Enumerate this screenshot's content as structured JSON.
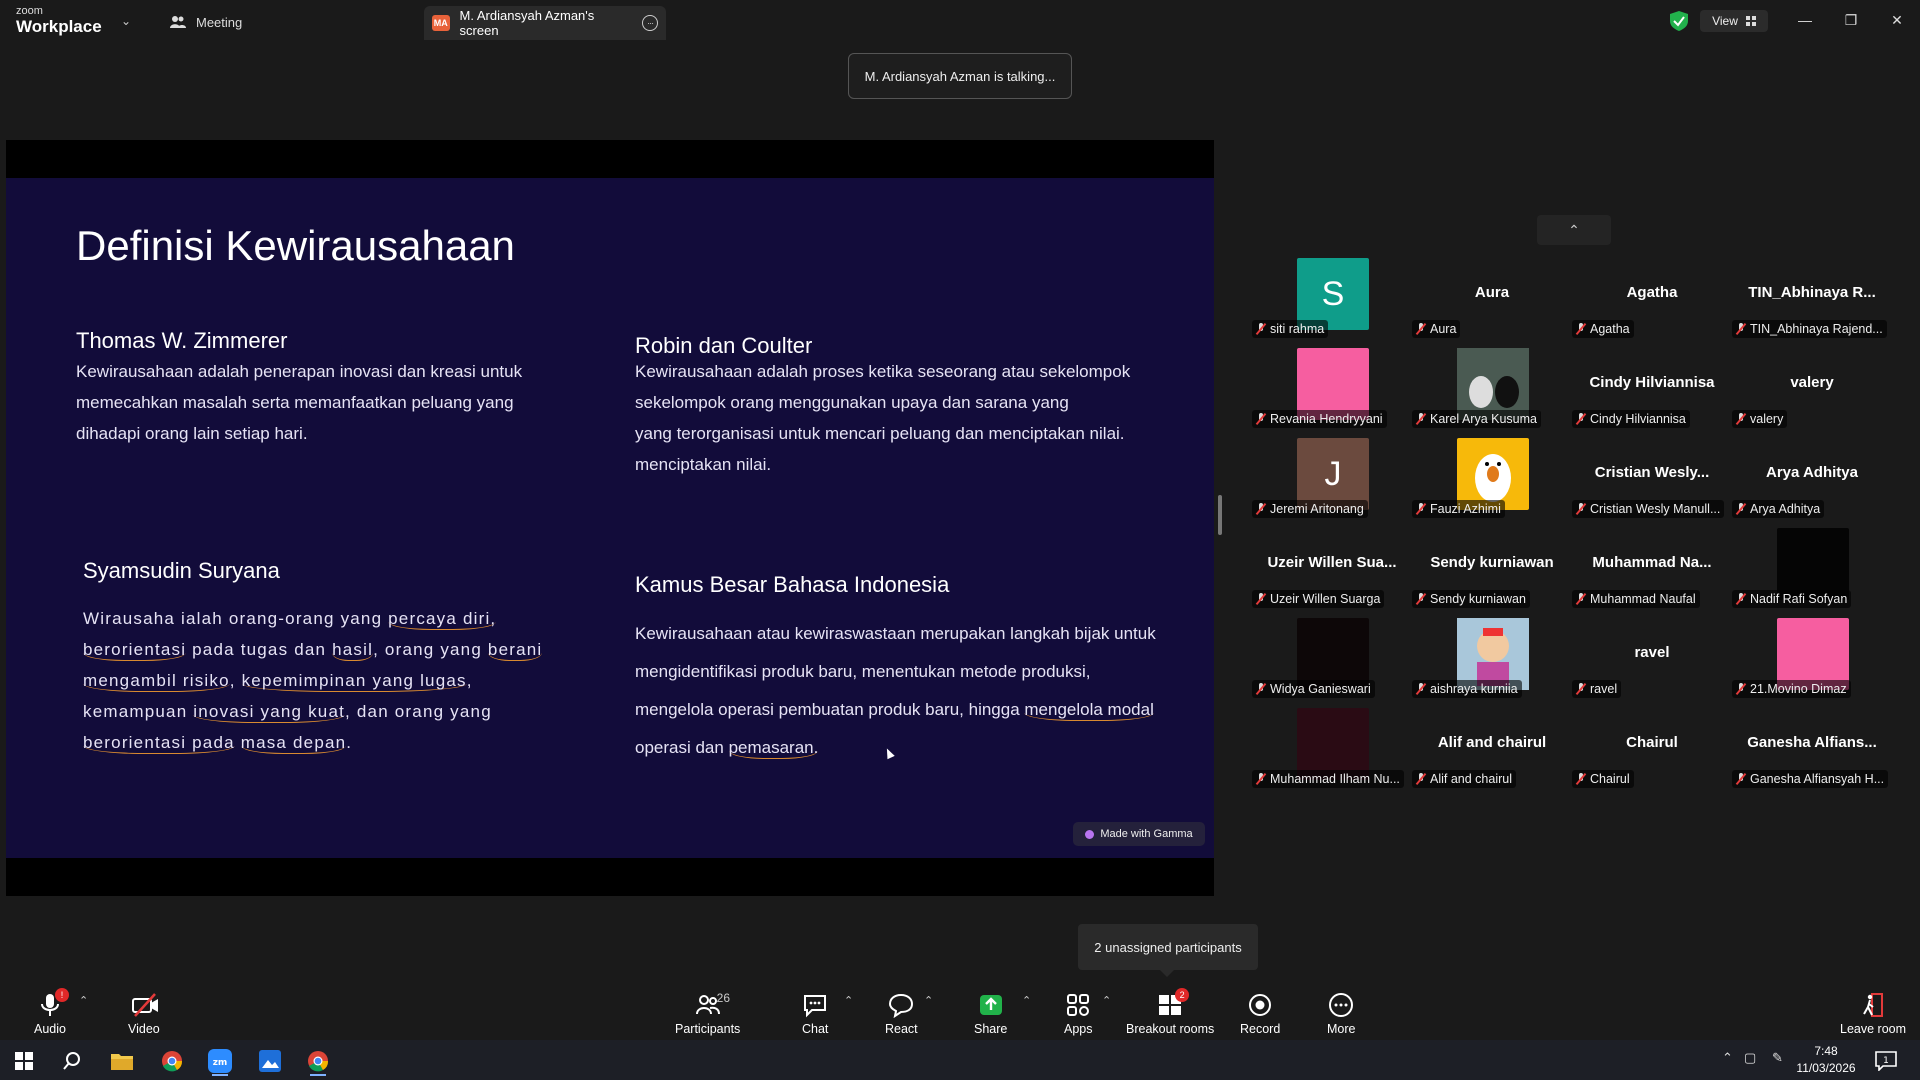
{
  "titlebar": {
    "brand_top": "zoom",
    "brand_bottom": "Workplace",
    "meeting_tab": "Meeting",
    "screen_tab_initials": "MA",
    "screen_tab": "M. Ardiansyah Azman's screen",
    "view_label": "View"
  },
  "talking": "M. Ardiansyah Azman is talking...",
  "slide": {
    "title": "Definisi Kewirausahaan",
    "s1_head": "Thomas W. Zimmerer",
    "s1_l1": "Kewirausahaan adalah penerapan inovasi dan kreasi untuk",
    "s1_l2": "memecahkan masalah serta memanfaatkan peluang yang",
    "s1_l3": "dihadapi orang lain setiap hari.",
    "s2_head": "Robin dan Coulter",
    "s2_l1": "Kewirausahaan adalah proses ketika seseorang atau sekelompok",
    "s2_l2": "sekelompok orang menggunakan upaya dan sarana yang",
    "s2_l3": "yang terorganisasi untuk mencari peluang dan menciptakan nilai.",
    "s2_l4": "menciptakan nilai.",
    "s3_head": "Syamsudin Suryana",
    "s3_l1a": "Wirausaha ialah orang-orang yang ",
    "s3_l1b": "percaya diri,",
    "s3_l2a": "berorientasi",
    "s3_l2b": " pada tugas dan ",
    "s3_l2c": "hasil",
    "s3_l2d": ", orang yang ",
    "s3_l2e": "berani",
    "s3_l3a": "mengambil risiko",
    "s3_l3b": ", ",
    "s3_l3c": "kepemimpinan yang lugas",
    "s3_l3d": ",",
    "s3_l4a": "kemampuan ",
    "s3_l4b": "inovasi yang kuat",
    "s3_l4c": ", dan orang yang",
    "s3_l5a": "berorientasi pada",
    "s3_l5b": " ",
    "s3_l5c": "masa depan",
    "s3_l5d": ".",
    "s4_head": "Kamus Besar Bahasa Indonesia",
    "s4_l1": "Kewirausahaan atau kewiraswastaan merupakan langkah bijak untuk",
    "s4_l2": "mengidentifikasi produk baru, menentukan metode produksi,",
    "s4_l3a": "mengelola operasi pembuatan produk baru, hingga ",
    "s4_l3b": "mengelola modal",
    "s4_l4a": "operasi dan ",
    "s4_l4b": "pemasaran.",
    "gamma": "Made with Gamma"
  },
  "participants": [
    {
      "label": "siti rahma",
      "avatar": "S",
      "avatar_color": "#0f9d8a"
    },
    {
      "label": "Aura",
      "big": "Aura"
    },
    {
      "label": "Agatha",
      "big": "Agatha"
    },
    {
      "label": "TIN_Abhinaya Rajend...",
      "big": "TIN_Abhinaya R..."
    },
    {
      "label": "Revania Hendryyani",
      "avatar_color": "#f65ea0"
    },
    {
      "label": "Karel Arya Kusuma",
      "avatar_color": "#3e4a4c",
      "photo": "cats"
    },
    {
      "label": "Cindy Hilviannisa",
      "big": "Cindy Hilviannisa"
    },
    {
      "label": "valery",
      "big": "valery"
    },
    {
      "label": "Jeremi Aritonang",
      "avatar": "J",
      "avatar_color": "#6b4a3e"
    },
    {
      "label": "Fauzi Azhimi",
      "avatar_color": "#f7b90a",
      "photo": "duck"
    },
    {
      "label": "Cristian Wesly Manull...",
      "big": "Cristian  Wesly..."
    },
    {
      "label": "Arya Adhitya",
      "big": "Arya Adhitya"
    },
    {
      "label": "Uzeir Willen Suarga",
      "big": "Uzeir  Willen  Sua..."
    },
    {
      "label": "Sendy kurniawan",
      "big": "Sendy kurniawan"
    },
    {
      "label": "Muhammad Naufal",
      "big": "Muhammad  Na..."
    },
    {
      "label": "Nadif Rafi Sofyan",
      "avatar_color": "#050505"
    },
    {
      "label": "Widya Ganieswari",
      "avatar_color": "#0d0708"
    },
    {
      "label": "aishraya kurniia",
      "avatar_color": "#9ac0d8",
      "photo": "toy"
    },
    {
      "label": "ravel",
      "big": "ravel"
    },
    {
      "label": "21.Movino Dimaz",
      "avatar_color": "#f65ea0"
    },
    {
      "label": "Muhammad Ilham Nu...",
      "avatar_color": "#2a0b14"
    },
    {
      "label": "Alif and chairul",
      "big": "Alif and chairul"
    },
    {
      "label": "Chairul",
      "big": "Chairul"
    },
    {
      "label": "Ganesha Alfiansyah H...",
      "big": "Ganesha  Alfians..."
    }
  ],
  "unassigned": "2 unassigned participants",
  "toolbar": {
    "audio": "Audio",
    "video": "Video",
    "participants": "Participants",
    "participants_count": "26",
    "chat": "Chat",
    "react": "React",
    "share": "Share",
    "apps": "Apps",
    "breakout": "Breakout rooms",
    "breakout_badge": "2",
    "record": "Record",
    "more": "More",
    "leave": "Leave room"
  },
  "taskbar": {
    "time": "7:48",
    "date": "11/03/2026",
    "notif": "1"
  }
}
